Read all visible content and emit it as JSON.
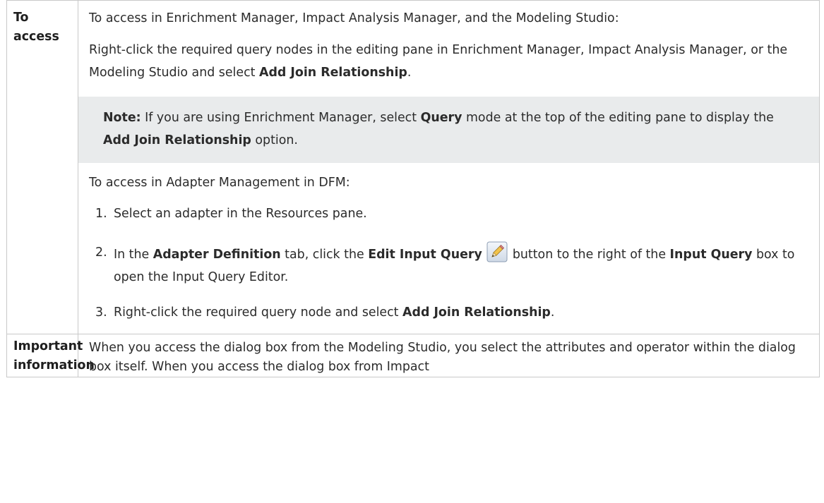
{
  "table": {
    "row1": {
      "label": "To access",
      "intro": "To access in Enrichment Manager, Impact Analysis Manager, and the Modeling Studio:",
      "rightclick": {
        "before": "Right-click the required query nodes in the editing pane in Enrichment Manager, Impact Analysis Manager, or the Modeling Studio and select ",
        "bold": "Add Join Relationship",
        "after": "."
      },
      "note": {
        "label": "Note:",
        "part1": " If you are using Enrichment Manager, select ",
        "bold1": "Query",
        "part2": " mode at the top of the editing pane to display the ",
        "bold2": "Add Join Relationship",
        "part3": " option."
      },
      "adapter_intro": "To access in Adapter Management in DFM:",
      "steps": {
        "s1": {
          "num": "1.",
          "text": "Select an adapter in the Resources pane."
        },
        "s2": {
          "num": "2.",
          "t1": "In the ",
          "b1": "Adapter Definition",
          "t2": " tab, click the ",
          "b2": "Edit Input Query",
          "t3": " button to the right of the ",
          "b3": "Input Query",
          "t4": " box to open the Input Query Editor."
        },
        "s3": {
          "num": "3.",
          "t1": "Right-click the required query node and select ",
          "b1": "Add Join Relationship",
          "t2": "."
        }
      }
    },
    "row2": {
      "label_line1": "Important",
      "label_line2": "information",
      "text": "When you access the dialog box from the Modeling Studio, you select the attributes and operator within the dialog box itself. When you access the dialog box from Impact"
    }
  },
  "icons": {
    "edit": "pencil-edit-icon"
  },
  "colors": {
    "border": "#c9c9c9",
    "note_bg": "#e9ebec",
    "text": "#2b2b2b"
  }
}
